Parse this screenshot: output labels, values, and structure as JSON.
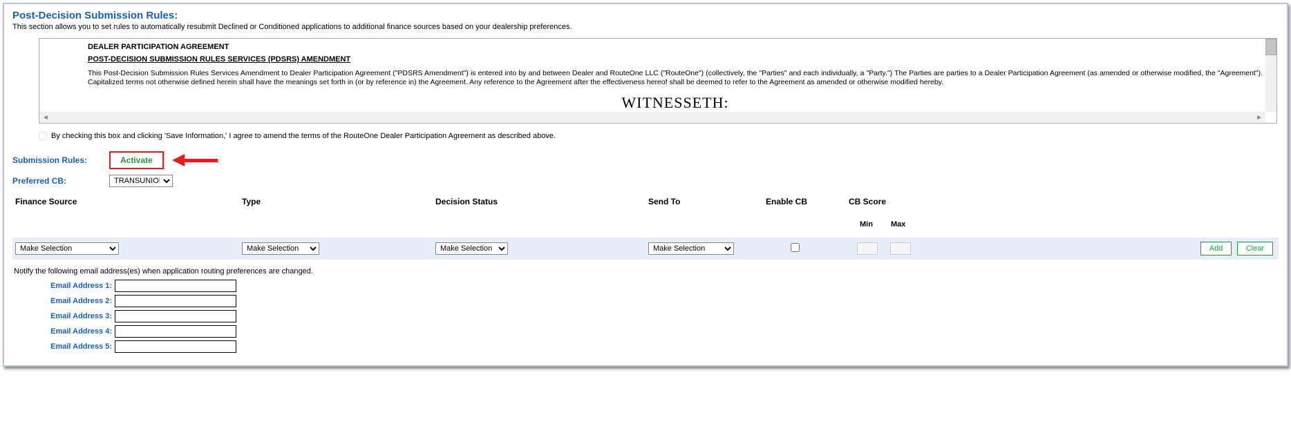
{
  "header": {
    "title": "Post-Decision Submission Rules:",
    "description": "This section allows you to set rules to automatically resubmit Declined or Conditioned applications to additional finance sources based on your dealership preferences."
  },
  "agreement": {
    "heading1": "DEALER PARTICIPATION AGREEMENT",
    "heading2": "POST-DECISION SUBMISSION RULES SERVICES (PDSRS) AMENDMENT",
    "paragraph": "This Post-Decision Submission Rules Services Amendment to Dealer Participation Agreement (\"PDSRS Amendment\") is entered into by and between Dealer and RouteOne LLC (\"RouteOne\") (collectively, the \"Parties\" and each individually, a \"Party.\") The Parties are parties to a Dealer Participation Agreement (as amended or otherwise modified, the \"Agreement\"). Capitalized terms not otherwise defined herein shall have the meanings set forth in (or by reference in) the Agreement. Any reference to the Agreement after the effectiveness hereof shall be deemed to refer to the Agreement as amended or otherwise modified hereby.",
    "witnesseth": "WITNESSETH:"
  },
  "consent": {
    "text": "By checking this box and clicking 'Save Information,' I agree to amend the terms of the RouteOne Dealer Participation Agreement as described above."
  },
  "labels": {
    "submission_rules": "Submission Rules:",
    "preferred_cb": "Preferred CB:",
    "activate": "Activate",
    "preferred_cb_value": "TRANSUNION"
  },
  "columns": {
    "finance_source": "Finance Source",
    "type": "Type",
    "decision_status": "Decision Status",
    "send_to": "Send To",
    "enable_cb": "Enable CB",
    "cb_score": "CB Score",
    "min": "Min",
    "max": "Max"
  },
  "row": {
    "finance_source": "Make Selection",
    "type": "Make Selection",
    "decision_status": "Make Selection",
    "send_to": "Make Selection",
    "min": "",
    "max": "",
    "add": "Add",
    "clear": "Clear"
  },
  "notify_text": "Notify the following email address(es) when application routing preferences are changed.",
  "emails": {
    "label1": "Email Address 1:",
    "label2": "Email Address 2:",
    "label3": "Email Address 3:",
    "label4": "Email Address 4:",
    "label5": "Email Address 5:",
    "value1": "",
    "value2": "",
    "value3": "",
    "value4": "",
    "value5": ""
  }
}
